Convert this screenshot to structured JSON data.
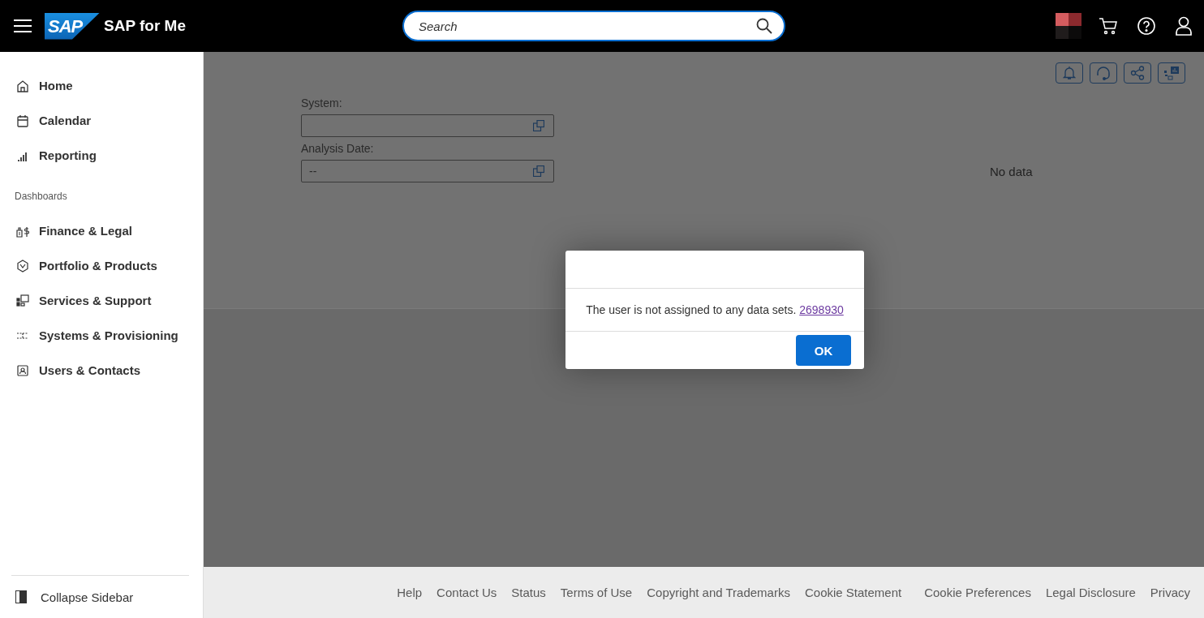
{
  "header": {
    "logo": "SAP",
    "title": "SAP for Me",
    "search": {
      "placeholder": "Search"
    }
  },
  "sidebar": {
    "items": [
      {
        "label": "Home",
        "selected": false
      },
      {
        "label": "Calendar",
        "selected": false
      },
      {
        "label": "Reporting",
        "selected": false
      }
    ],
    "section_title": "Dashboards",
    "dashboards": [
      {
        "label": "Finance & Legal",
        "selected": false
      },
      {
        "label": "Portfolio & Products",
        "selected": false
      },
      {
        "label": "Services & Support",
        "selected": false
      },
      {
        "label": "Systems & Provisioning",
        "selected": false
      },
      {
        "label": "Users & Contacts",
        "selected": false
      }
    ],
    "collapse": "Collapse Sidebar"
  },
  "filters": [
    {
      "label": "System:"
    },
    {
      "label": "Analysis Date:",
      "value": "--"
    }
  ],
  "no_data": "No data",
  "dialog": {
    "message": "The user is not assigned to any data sets.",
    "link": "2698930",
    "button": "OK"
  },
  "footer": {
    "links": [
      "Help",
      "Contact Us",
      "Status",
      "Terms of Use",
      "Copyright and Trademarks",
      "Cookie Statement",
      "Cookie Preferences",
      "Legal Disclosure",
      "Privacy"
    ]
  }
}
